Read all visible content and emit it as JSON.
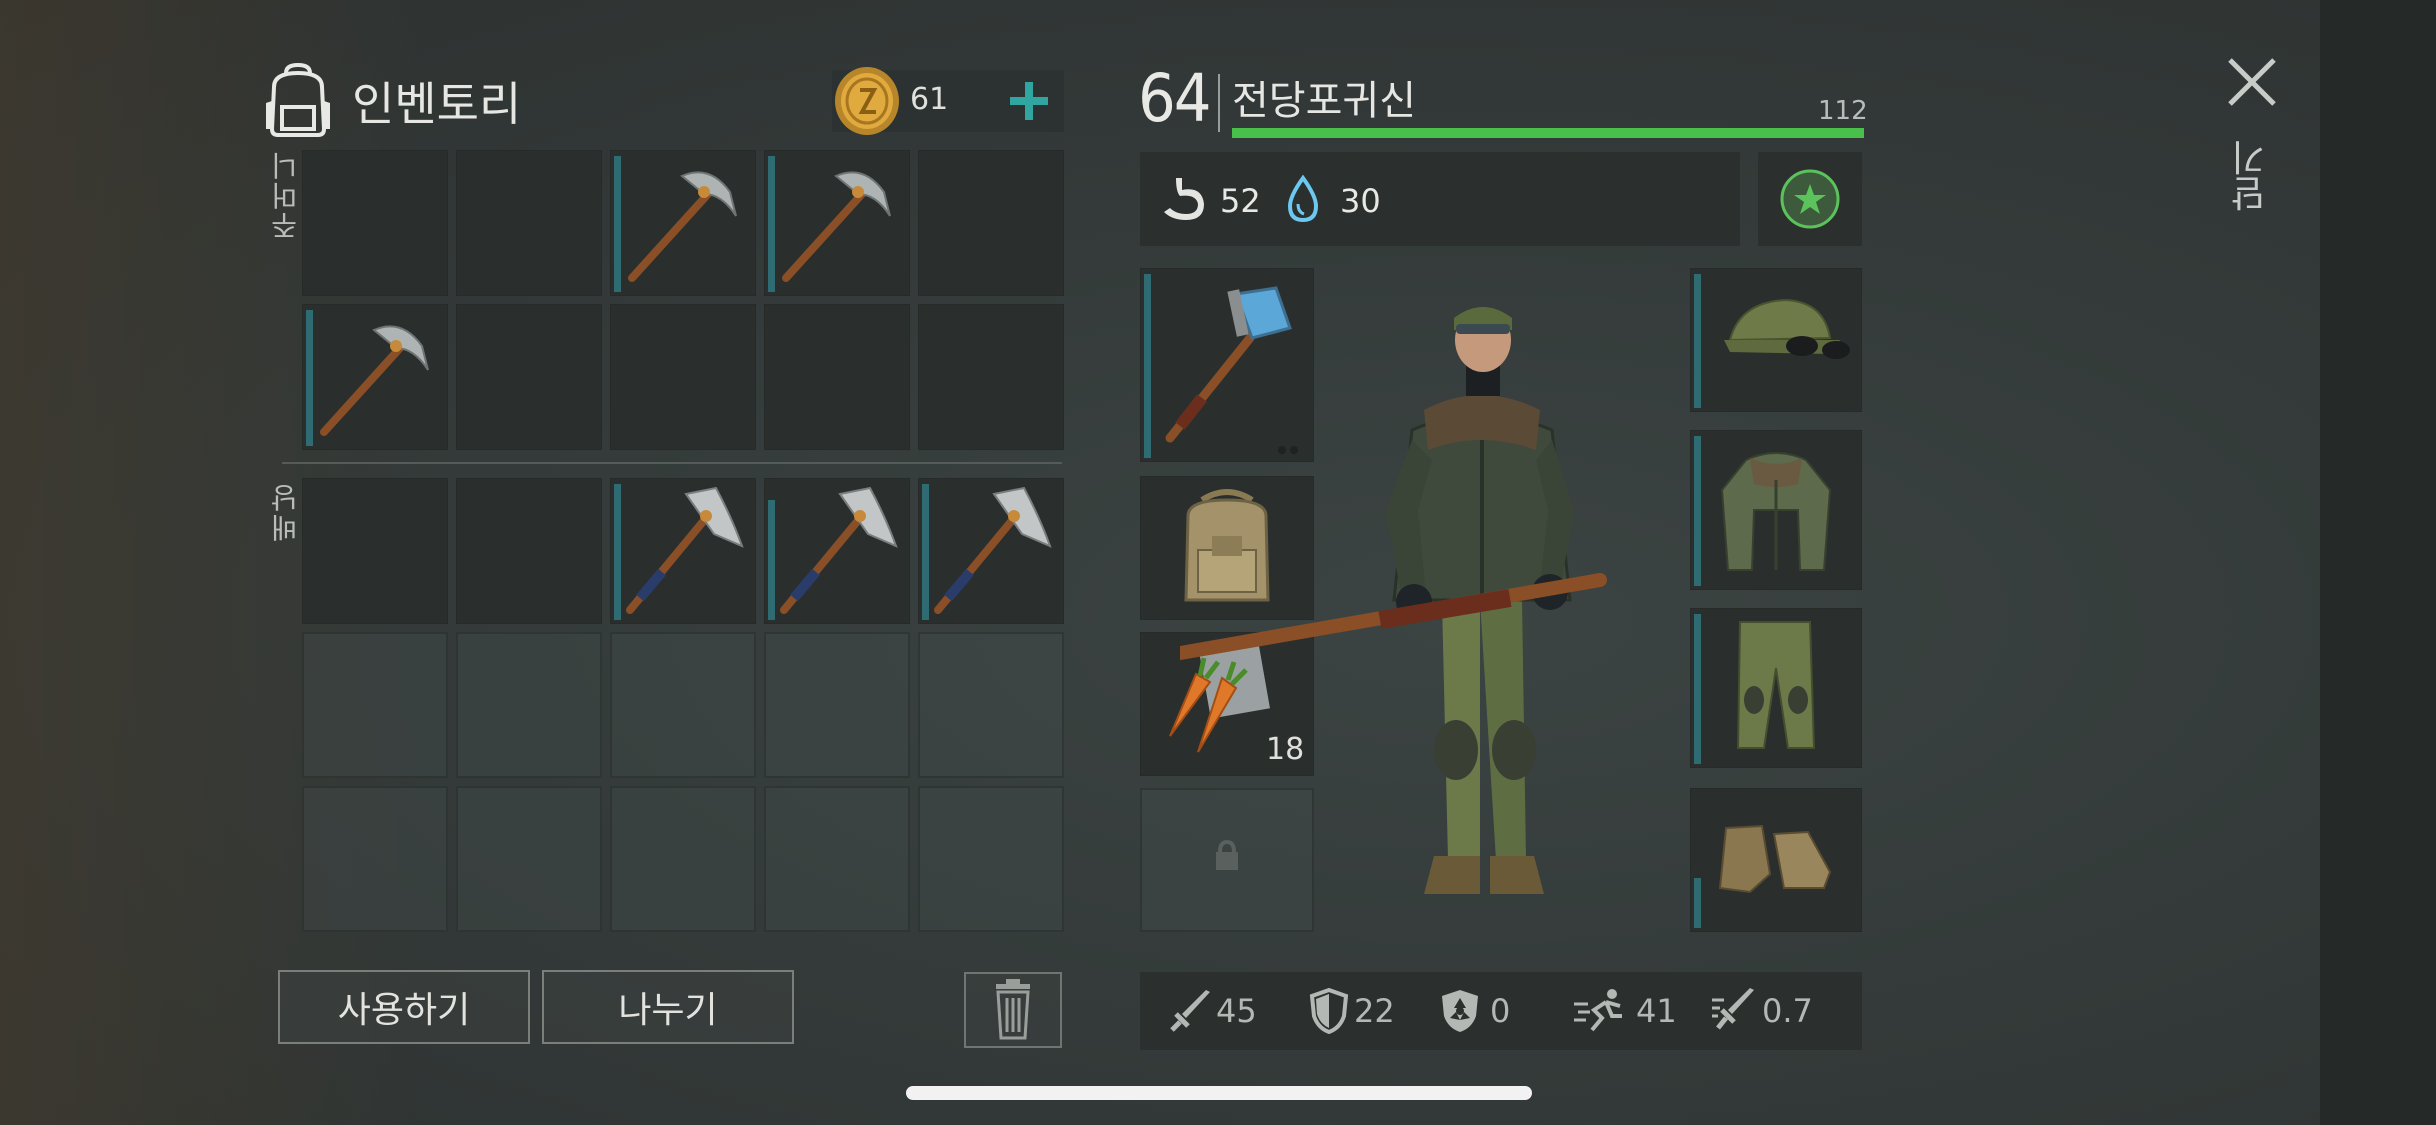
{
  "inventory": {
    "title": "인벤토리",
    "coins": "61",
    "pockets_label": "주머니",
    "backpack_label": "배낭",
    "use_button": "사용하기",
    "split_button": "나누기",
    "stack_count": "18"
  },
  "character": {
    "level": "64",
    "name": "전당포귀신",
    "xp_max": "112",
    "hunger": "52",
    "thirst": "30"
  },
  "stats": {
    "attack": "45",
    "defense": "22",
    "radiation": "0",
    "speed": "41",
    "attack_speed": "0.7"
  },
  "close_label": "닫기",
  "colors": {
    "xp_bar": "#48c04a",
    "accent_teal": "#2fa6a0",
    "favorite_green": "#5cc25c"
  },
  "icons": [
    "backpack-icon",
    "coin-icon",
    "plus-icon",
    "pickaxe-icon",
    "hatchet-icon",
    "sledgehammer-icon",
    "carrot-icon",
    "lock-icon",
    "trash-icon",
    "stomach-icon",
    "water-drop-icon",
    "star-icon",
    "sword-icon",
    "shield-icon",
    "radiation-icon",
    "runner-icon",
    "attack-speed-icon",
    "close-icon"
  ]
}
